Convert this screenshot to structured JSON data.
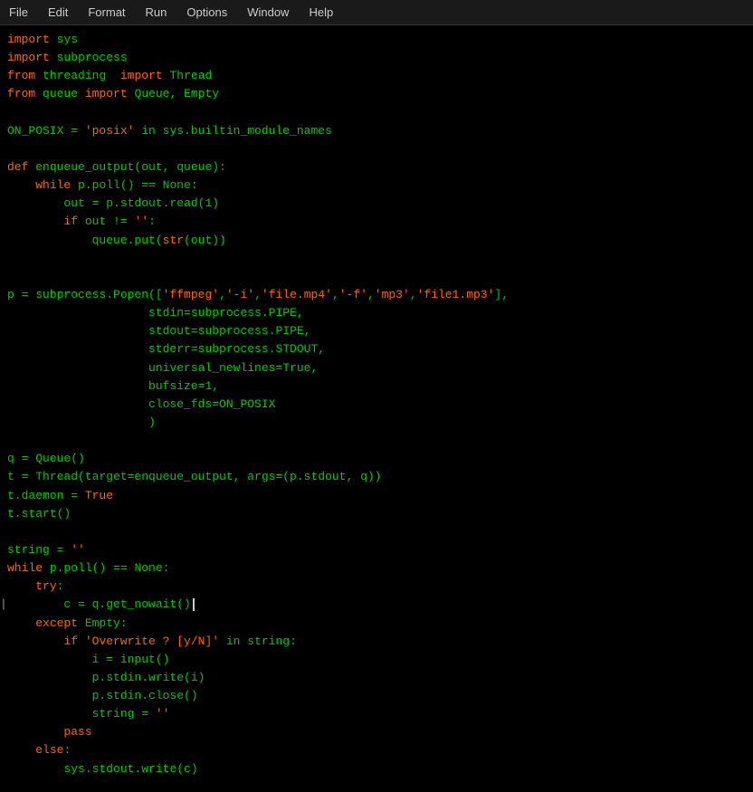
{
  "menubar": {
    "items": [
      "File",
      "Edit",
      "Format",
      "Run",
      "Options",
      "Window",
      "Help"
    ]
  },
  "code": {
    "lines": [
      {
        "id": 1,
        "text": "import sys"
      },
      {
        "id": 2,
        "text": "import subprocess"
      },
      {
        "id": 3,
        "text": "from threading  import Thread"
      },
      {
        "id": 4,
        "text": "from queue import Queue, Empty"
      },
      {
        "id": 5,
        "text": ""
      },
      {
        "id": 6,
        "text": "ON_POSIX = 'posix' in sys.builtin_module_names"
      },
      {
        "id": 7,
        "text": ""
      },
      {
        "id": 8,
        "text": "def enqueue_output(out, queue):"
      },
      {
        "id": 9,
        "text": "    while p.poll() == None:"
      },
      {
        "id": 10,
        "text": "        out = p.stdout.read(1)"
      },
      {
        "id": 11,
        "text": "        if out != '':"
      },
      {
        "id": 12,
        "text": "            queue.put(str(out))"
      },
      {
        "id": 13,
        "text": ""
      },
      {
        "id": 14,
        "text": ""
      },
      {
        "id": 15,
        "text": "p = subprocess.Popen(['ffmpeg','-i','file.mp4','-f','mp3','file1.mp3'],"
      },
      {
        "id": 16,
        "text": "                    stdin=subprocess.PIPE,"
      },
      {
        "id": 17,
        "text": "                    stdout=subprocess.PIPE,"
      },
      {
        "id": 18,
        "text": "                    stderr=subprocess.STDOUT,"
      },
      {
        "id": 19,
        "text": "                    universal_newlines=True,"
      },
      {
        "id": 20,
        "text": "                    bufsize=1,"
      },
      {
        "id": 21,
        "text": "                    close_fds=ON_POSIX"
      },
      {
        "id": 22,
        "text": "                    )"
      },
      {
        "id": 23,
        "text": ""
      },
      {
        "id": 24,
        "text": "q = Queue()"
      },
      {
        "id": 25,
        "text": "t = Thread(target=enqueue_output, args=(p.stdout, q))"
      },
      {
        "id": 26,
        "text": "t.daemon = True"
      },
      {
        "id": 27,
        "text": "t.start()"
      },
      {
        "id": 28,
        "text": ""
      },
      {
        "id": 29,
        "text": "string = ''"
      },
      {
        "id": 30,
        "text": "while p.poll() == None:"
      },
      {
        "id": 31,
        "text": "    try:"
      },
      {
        "id": 32,
        "text": "        c = q.get_nowait()"
      },
      {
        "id": 33,
        "text": "    except Empty:"
      },
      {
        "id": 34,
        "text": "        if 'Overwrite ? [y/N]' in string:"
      },
      {
        "id": 35,
        "text": "            i = input()"
      },
      {
        "id": 36,
        "text": "            p.stdin.write(i)"
      },
      {
        "id": 37,
        "text": "            p.stdin.close()"
      },
      {
        "id": 38,
        "text": "            string = ''"
      },
      {
        "id": 39,
        "text": "        pass"
      },
      {
        "id": 40,
        "text": "    else:"
      },
      {
        "id": 41,
        "text": "        sys.stdout.write(c)"
      }
    ]
  }
}
